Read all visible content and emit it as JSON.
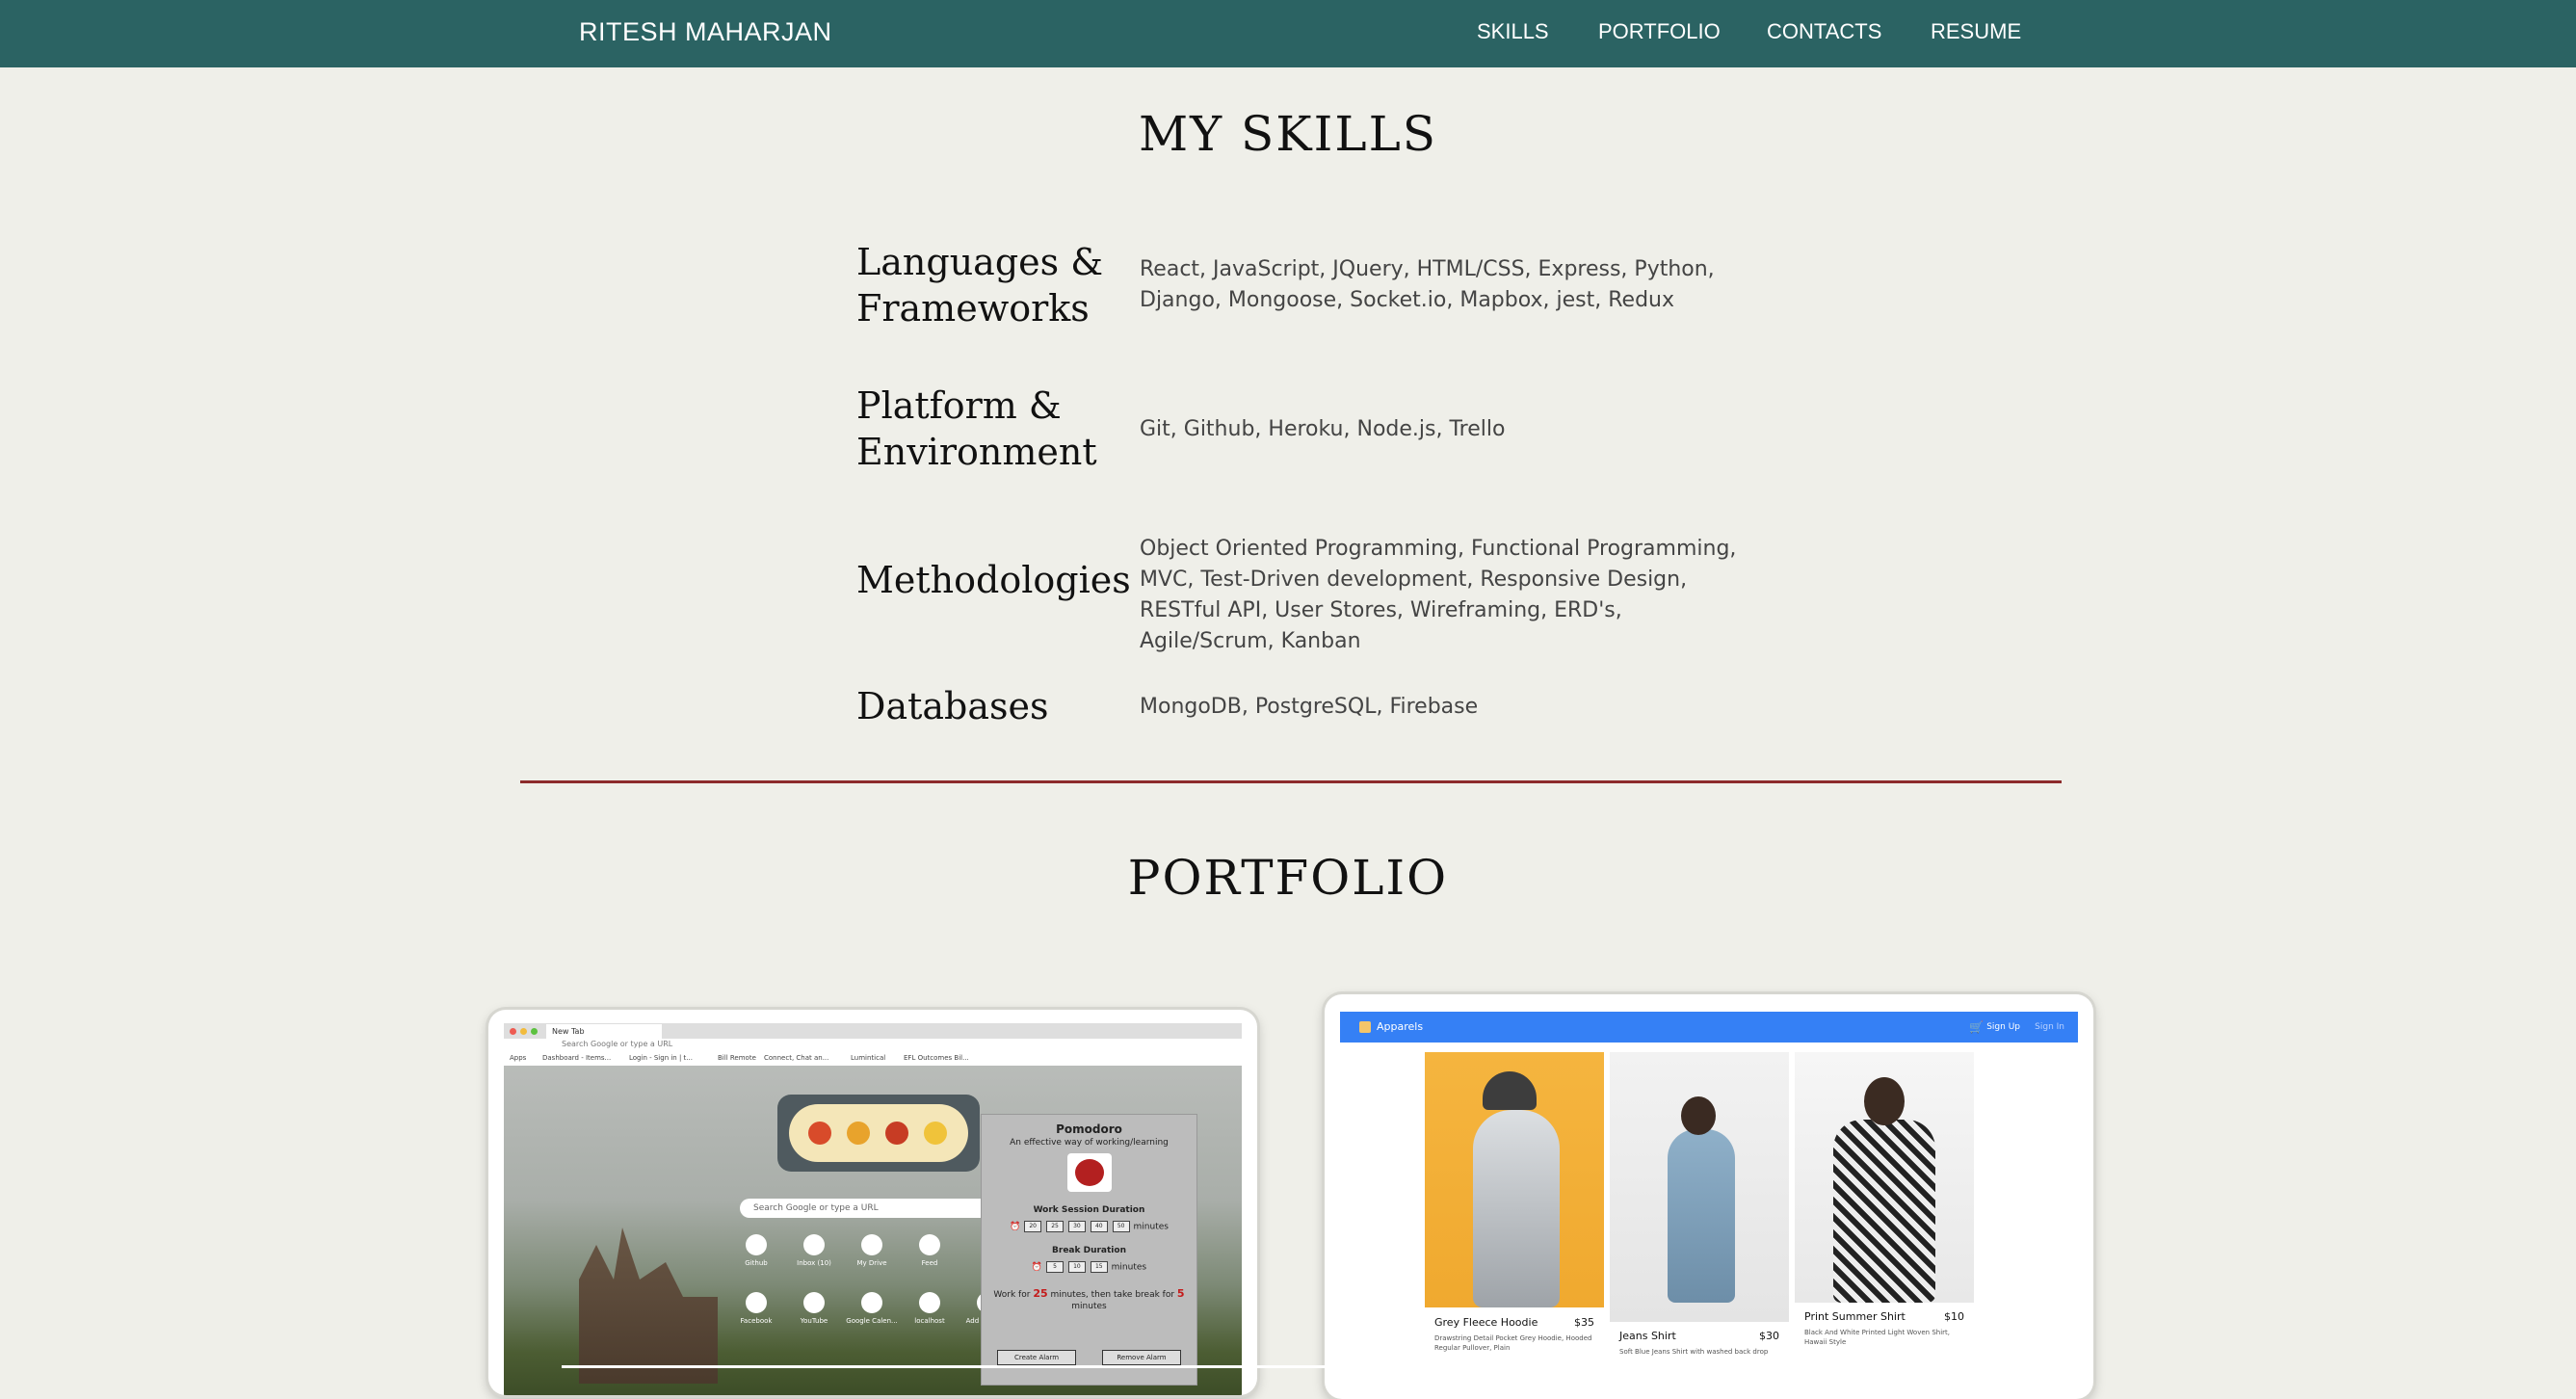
{
  "nav": {
    "brand": "RITESH MAHARJAN",
    "links": [
      "SKILLS",
      "PORTFOLIO",
      "CONTACTS",
      "RESUME"
    ]
  },
  "skills": {
    "title": "MY SKILLS",
    "items": [
      {
        "name": "Languages & Frameworks",
        "desc": "React, JavaScript, JQuery, HTML/CSS, Express, Python, Django, Mongoose, Socket.io, Mapbox, jest, Redux"
      },
      {
        "name": "Platform & Environment",
        "desc": "Git, Github, Heroku, Node.js, Trello"
      },
      {
        "name": "Methodologies",
        "desc": "Object Oriented Programming, Functional Programming, MVC, Test-Driven development, Responsive Design, RESTful API, User Stores, Wireframing, ERD's, Agile/Scrum, Kanban"
      },
      {
        "name": "Databases",
        "desc": "MongoDB, PostgreSQL, Firebase"
      }
    ]
  },
  "portfolio": {
    "title": "PORTFOLIO",
    "pomodoro": {
      "tab": "New Tab",
      "url_placeholder": "Search Google or type a URL",
      "bookmarks": [
        "Apps",
        "Dashboard - Items...",
        "Login - Sign in | t...",
        "Bill Remote",
        "Connect, Chat an...",
        "Lumintical",
        "EFL Outcomes Bil..."
      ],
      "search_placeholder": "Search Google or type a URL",
      "shortcuts": [
        "Github",
        "Inbox (10)",
        "My Drive",
        "Feed",
        "Facebook",
        "YouTube",
        "Google Calen...",
        "localhost",
        "Add shortcut"
      ],
      "title": "Pomodoro",
      "subtitle": "An effective way of working/learning",
      "work_label": "Work Session Duration",
      "work_options": [
        "20",
        "25",
        "30",
        "40",
        "50"
      ],
      "break_label": "Break Duration",
      "break_options": [
        "5",
        "10",
        "15"
      ],
      "unit": "minutes",
      "note_prefix": "Work for",
      "note_work": "25",
      "note_mid": "minutes, then take break for",
      "note_break": "5",
      "note_suffix": "minutes",
      "create_btn": "Create Alarm",
      "remove_btn": "Remove Alarm"
    },
    "shop": {
      "brand": "Apparels",
      "signup": "Sign Up",
      "signin": "Sign In",
      "products": [
        {
          "name": "Grey Fleece Hoodie",
          "price": "$35",
          "desc": "Drawstring Detail Pocket Grey Hoodie, Hooded Regular Pullover, Plain"
        },
        {
          "name": "Jeans Shirt",
          "price": "$30",
          "desc": "Soft Blue Jeans Shirt with washed back drop"
        },
        {
          "name": "Print Summer Shirt",
          "price": "$10",
          "desc": "Black And White Printed Light Woven Shirt, Hawaii Style"
        }
      ]
    }
  },
  "colors": {
    "nav": "#2b6363",
    "background": "#efefe9",
    "divider": "#8c2b2b",
    "shop_bar": "#3580f5"
  }
}
